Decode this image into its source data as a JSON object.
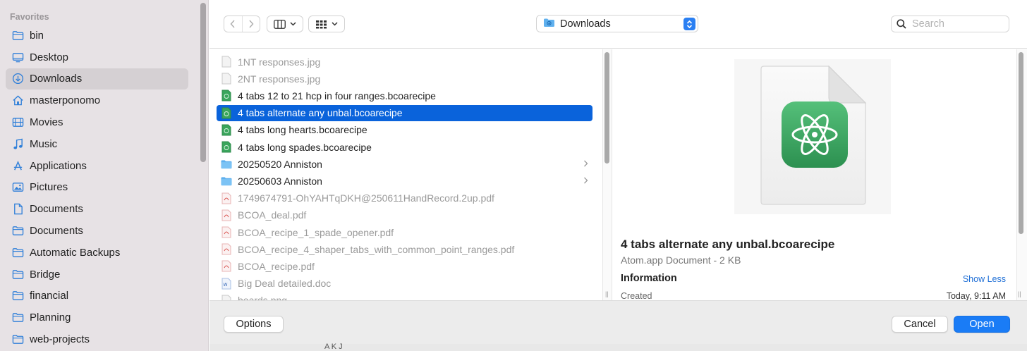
{
  "sidebar": {
    "heading": "Favorites",
    "items": [
      {
        "label": "bin",
        "icon": "folder-icon"
      },
      {
        "label": "Desktop",
        "icon": "desktop-icon"
      },
      {
        "label": "Downloads",
        "icon": "downloads-icon",
        "selected": true
      },
      {
        "label": "masterponomo",
        "icon": "home-icon"
      },
      {
        "label": "Movies",
        "icon": "movies-icon"
      },
      {
        "label": "Music",
        "icon": "music-icon"
      },
      {
        "label": "Applications",
        "icon": "applications-icon"
      },
      {
        "label": "Pictures",
        "icon": "pictures-icon"
      },
      {
        "label": "Documents",
        "icon": "document-icon"
      },
      {
        "label": "Documents",
        "icon": "folder-icon"
      },
      {
        "label": "Automatic Backups",
        "icon": "folder-icon"
      },
      {
        "label": "Bridge",
        "icon": "folder-icon"
      },
      {
        "label": "financial",
        "icon": "folder-icon"
      },
      {
        "label": "Planning",
        "icon": "folder-icon"
      },
      {
        "label": "web-projects",
        "icon": "folder-icon"
      }
    ]
  },
  "toolbar": {
    "location": "Downloads",
    "search_placeholder": "Search"
  },
  "files": [
    {
      "name": "1NT responses.jpg",
      "type": "image",
      "dim": true
    },
    {
      "name": "2NT responses.jpg",
      "type": "image",
      "dim": true
    },
    {
      "name": "4 tabs 12 to 21 hcp in four ranges.bcoarecipe",
      "type": "atom"
    },
    {
      "name": "4 tabs alternate any unbal.bcoarecipe",
      "type": "atom",
      "selected": true
    },
    {
      "name": "4 tabs long hearts.bcoarecipe",
      "type": "atom"
    },
    {
      "name": "4 tabs long spades.bcoarecipe",
      "type": "atom"
    },
    {
      "name": "20250520 Anniston",
      "type": "folder",
      "chevron": true
    },
    {
      "name": "20250603 Anniston",
      "type": "folder",
      "chevron": true
    },
    {
      "name": "1749674791-OhYAHTqDKH@250611HandRecord.2up.pdf",
      "type": "pdf",
      "dim": true
    },
    {
      "name": "BCOA_deal.pdf",
      "type": "pdf",
      "dim": true
    },
    {
      "name": "BCOA_recipe_1_spade_opener.pdf",
      "type": "pdf",
      "dim": true
    },
    {
      "name": "BCOA_recipe_4_shaper_tabs_with_common_point_ranges.pdf",
      "type": "pdf",
      "dim": true
    },
    {
      "name": "BCOA_recipe.pdf",
      "type": "pdf",
      "dim": true
    },
    {
      "name": "Big Deal detailed.doc",
      "type": "doc",
      "dim": true
    },
    {
      "name": "boards.png",
      "type": "image",
      "dim": true
    }
  ],
  "preview": {
    "name": "4 tabs alternate any unbal.bcoarecipe",
    "kind": "Atom.app Document - 2 KB",
    "info_heading": "Information",
    "show_less": "Show Less",
    "created_label": "Created",
    "created_value": "Today, 9:11 AM"
  },
  "buttons": {
    "options": "Options",
    "cancel": "Cancel",
    "open": "Open"
  },
  "colors": {
    "accent": "#0a63db",
    "open_button": "#1a7cf6",
    "atom_green": "#3aa55c"
  },
  "background_text": "A K J"
}
